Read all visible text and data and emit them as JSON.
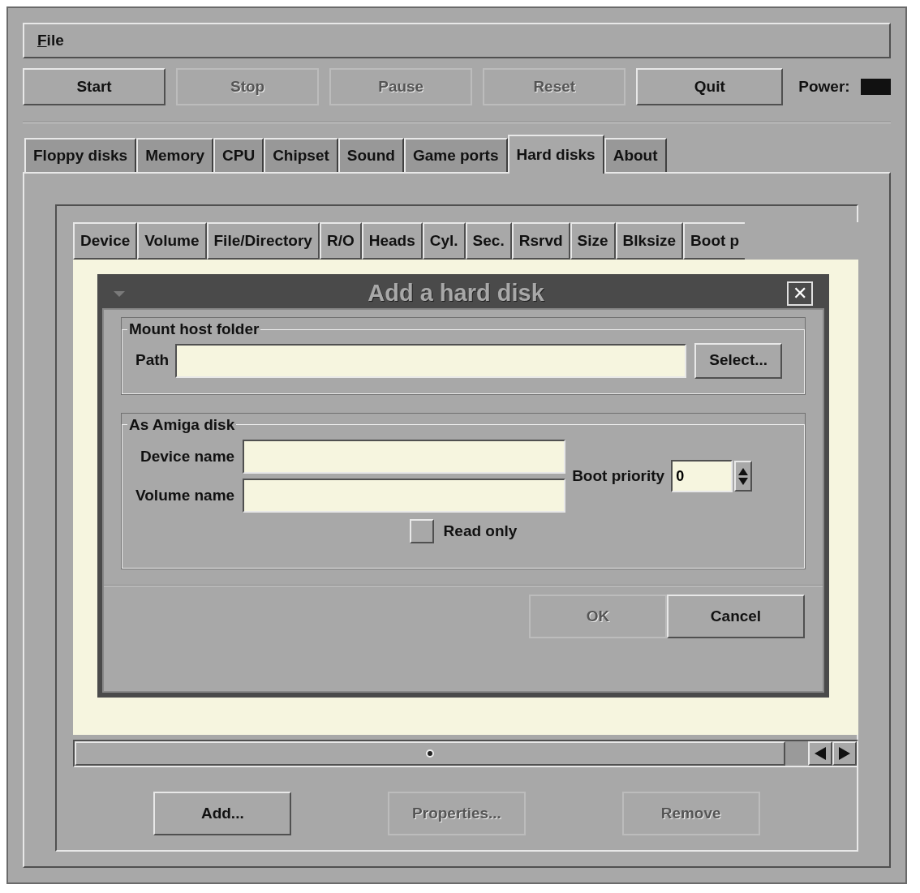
{
  "menu": [
    {
      "label": "File"
    }
  ],
  "toolbar": [
    {
      "label": "Start",
      "disabled": false
    },
    {
      "label": "Stop",
      "disabled": true
    },
    {
      "label": "Pause",
      "disabled": true
    },
    {
      "label": "Reset",
      "disabled": true
    },
    {
      "label": "Quit",
      "disabled": false
    }
  ],
  "power": {
    "label": "Power:",
    "on": false
  },
  "tabs": [
    {
      "label": "Floppy disks",
      "selected": false
    },
    {
      "label": "Memory",
      "selected": false
    },
    {
      "label": "CPU",
      "selected": false
    },
    {
      "label": "Chipset",
      "selected": false
    },
    {
      "label": "Sound",
      "selected": false
    },
    {
      "label": "Game ports",
      "selected": false
    },
    {
      "label": "Hard disks",
      "selected": true
    },
    {
      "label": "About",
      "selected": false
    }
  ],
  "table": {
    "columns": [
      "Device",
      "Volume",
      "File/Directory",
      "R/O",
      "Heads",
      "Cyl.",
      "Sec.",
      "Rsrvd",
      "Size",
      "Blksize",
      "Boot p"
    ]
  },
  "dialog": {
    "title": "Add a hard disk",
    "close": "✕",
    "mount": {
      "legend": "Mount host folder",
      "path_label": "Path",
      "select_button": "Select..."
    },
    "amiga": {
      "legend": "As Amiga disk",
      "device_label": "Device name",
      "volume_label": "Volume name",
      "boot_label": "Boot priority",
      "boot": "0",
      "read_only": {
        "label": "Read only",
        "checked": false
      }
    },
    "buttons": [
      {
        "label": "OK",
        "disabled": true
      },
      {
        "label": "Cancel",
        "disabled": false
      }
    ]
  },
  "actions": [
    {
      "label": "Add...",
      "disabled": false
    },
    {
      "label": "Properties...",
      "disabled": true
    },
    {
      "label": "Remove",
      "disabled": true
    }
  ]
}
